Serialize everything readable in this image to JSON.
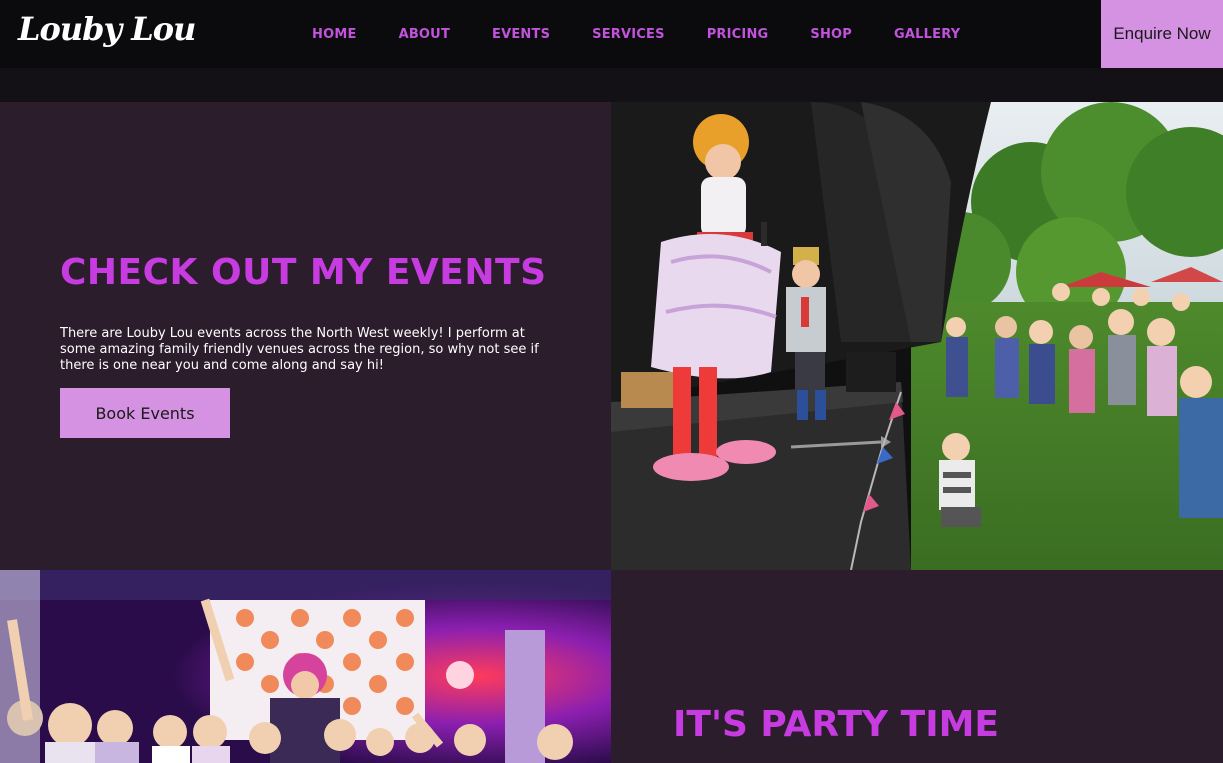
{
  "nav": {
    "logo": "Louby Lou",
    "items": [
      {
        "label": "HOME"
      },
      {
        "label": "ABOUT"
      },
      {
        "label": "EVENTS"
      },
      {
        "label": "SERVICES"
      },
      {
        "label": "PRICING"
      },
      {
        "label": "SHOP"
      },
      {
        "label": "GALLERY"
      }
    ],
    "enquire_label": "Enquire Now"
  },
  "events_section": {
    "title": "CHECK OUT MY EVENTS",
    "body": "There are Louby Lou events across the North West weekly! I perform at some amazing family friendly venues across the region, so why not see if there is one near you and come along and say hi!",
    "button_label": "Book Events"
  },
  "party_section": {
    "title": "IT'S PARTY TIME"
  },
  "colors": {
    "accent_purple": "#c73ce0",
    "button_pink": "#d591e2",
    "panel_bg": "#2b1d2c",
    "nav_bg": "#0b0a0c"
  }
}
